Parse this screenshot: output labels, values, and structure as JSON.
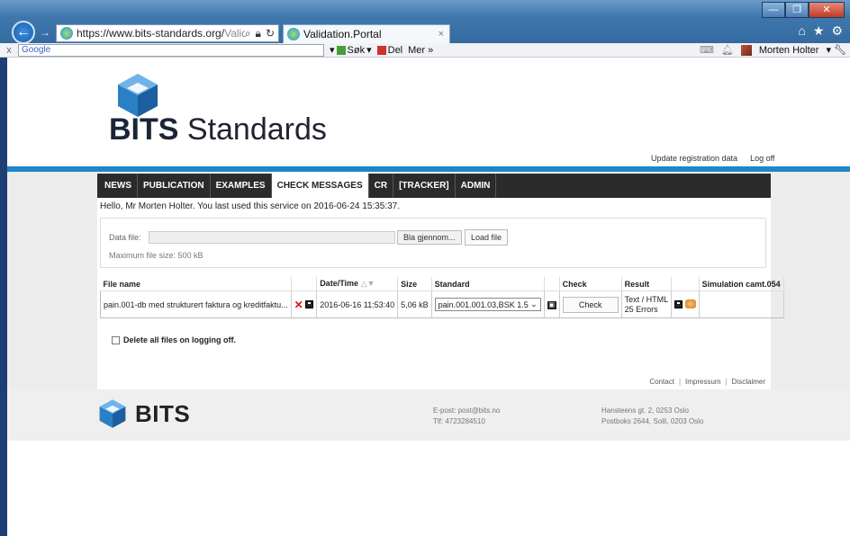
{
  "browser": {
    "address_url": "https://www.bits-standards.org/",
    "address_dim": "Valid",
    "tab_title": "Validation.Portal",
    "tab_close": "×",
    "window_minimize": "—",
    "window_restore": "❐",
    "window_close": "✕",
    "toolbar_close": "x",
    "google_placeholder": "Google",
    "sok_label": "Søk",
    "del_label": "Del",
    "mer_label": "Mer »",
    "user_name": "Morten Holter",
    "accent_color": "#3f77ad"
  },
  "header": {
    "brand_bold": "BITS",
    "brand_rest": " Standards",
    "update_link": "Update registration data",
    "logoff_link": "Log off",
    "bar_color": "#1f86c8"
  },
  "nav": {
    "items": [
      {
        "label": "NEWS",
        "active": false
      },
      {
        "label": "PUBLICATION",
        "active": false
      },
      {
        "label": "EXAMPLES",
        "active": false
      },
      {
        "label": "CHECK MESSAGES",
        "active": true
      },
      {
        "label": "CR",
        "active": false
      },
      {
        "label": "[TRACKER]",
        "active": false
      },
      {
        "label": "ADMIN",
        "active": false
      }
    ]
  },
  "main": {
    "greeting": "Hello, Mr Morten Holter. You last used this service on 2016-06-24 15:35:37.",
    "data_file_label": "Data file:",
    "browse_label": "Bla gjennom...",
    "load_label": "Load file",
    "max_size": "Maximum file size: 500 kB",
    "table": {
      "headers": {
        "file": "File name",
        "date": "Date/Time",
        "sort": "△▼",
        "size": "Size",
        "standard": "Standard",
        "check": "Check",
        "result": "Result",
        "simulation": "Simulation camt.054"
      },
      "row": {
        "file": "pain.001-db med strukturert faktura og kreditfaktu...",
        "date": "2016-06-16 11:53:40",
        "size": "5,06 kB",
        "standard": "pain.001.001.03,BSK 1.5",
        "check_label": "Check",
        "result_line1": "Text / HTML",
        "result_line2": "25 Errors"
      }
    },
    "delete_all_label": "Delete all files on logging off."
  },
  "footer_links": {
    "contact": "Contact",
    "impressum": "Impressum",
    "disclaimer": "Disclaimer",
    "sep": "|"
  },
  "footer": {
    "logo_text": "BITS",
    "email": "E-post: post@bits.no",
    "phone": "Tlf: 4723284510",
    "address1": "Hansteens gt. 2, 0253 Oslo",
    "address2": "Postboks 2644, Solli, 0203 Oslo"
  }
}
